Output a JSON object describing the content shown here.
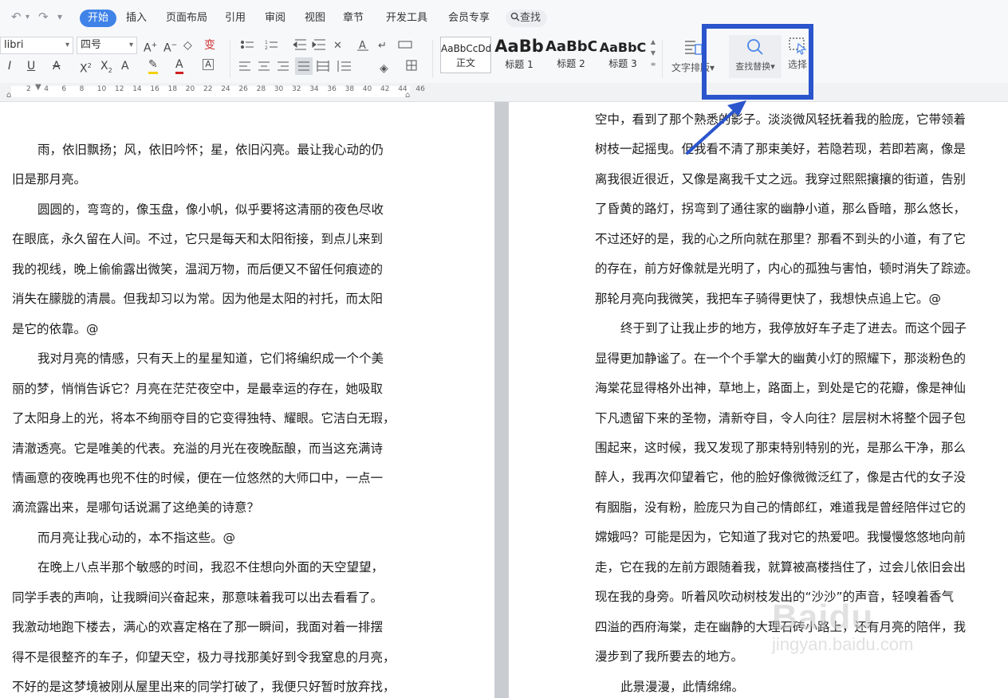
{
  "menu": {
    "tabs": [
      "开始",
      "插入",
      "页面布局",
      "引用",
      "审阅",
      "视图",
      "章节",
      "开发工具",
      "会员专享"
    ],
    "active_tab": "开始",
    "search_label": "查找",
    "undo_icon": "↶",
    "redo_icon": "↷"
  },
  "ribbon": {
    "font_name": "libri",
    "font_size": "四号",
    "styles": [
      {
        "sample": "AaBbCcDd",
        "name": "正文"
      },
      {
        "sample": "AaBb",
        "name": "标题 1"
      },
      {
        "sample": "AaBbC",
        "name": "标题 2"
      },
      {
        "sample": "AaBbC",
        "name": "标题 3"
      }
    ],
    "text_layout_label": "文字排版",
    "find_replace_label": "查找替换",
    "select_label": "选择",
    "tools_row1": [
      "A⁺",
      "A⁻",
      "♦",
      "变"
    ],
    "tools_row2": [
      "I",
      "U",
      "A",
      "X²",
      "X₂",
      "A",
      "A",
      "A"
    ]
  },
  "ruler": {
    "numbers": [
      "2",
      "4",
      "6",
      "8",
      "10",
      "12",
      "14",
      "16",
      "18",
      "20",
      "22",
      "24",
      "26",
      "28",
      "30",
      "32",
      "34",
      "36",
      "38",
      "40",
      "42",
      "44",
      "46"
    ]
  },
  "document": {
    "left_page": [
      {
        "text": "雨，依旧飘扬；风，依旧吟怀；星，依旧闪亮。最让我心动的仍",
        "indent": true
      },
      {
        "text": "旧是那月亮。",
        "indent": false
      },
      {
        "text": "圆圆的，弯弯的，像玉盘，像小帆，似乎要将这清丽的夜色尽收",
        "indent": true
      },
      {
        "text": "在眼底，永久留在人间。不过，它只是每天和太阳衔接，到点儿来到",
        "indent": false
      },
      {
        "text": "我的视线，晚上偷偷露出微笑，温润万物，而后便又不留任何痕迹的",
        "indent": false
      },
      {
        "text": "消失在朦胧的清晨。但我却习以为常。因为他是太阳的衬托，而太阳",
        "indent": false
      },
      {
        "text": "是它的依靠。@",
        "indent": false
      },
      {
        "text": "我对月亮的情感，只有天上的星星知道，它们将编织成一个个美",
        "indent": true
      },
      {
        "text": "丽的梦，悄悄告诉它？月亮在茫茫夜空中，是最幸运的存在，她吸取",
        "indent": false
      },
      {
        "text": "了太阳身上的光，将本不绚丽夺目的它变得独特、耀眼。它洁白无瑕，",
        "indent": false
      },
      {
        "text": "清澈透亮。它是唯美的代表。充溢的月光在夜晚酝酿，而当这充满诗",
        "indent": false
      },
      {
        "text": "情画意的夜晚再也兜不住的时候，便在一位悠然的大师口中，一点一",
        "indent": false
      },
      {
        "text": "滴流露出来，是哪句话说漏了这绝美的诗意？",
        "indent": false
      },
      {
        "text": "而月亮让我心动的，本不指这些。@",
        "indent": true
      },
      {
        "text": "在晚上八点半那个敏感的时间，我忍不住想向外面的天空望望，",
        "indent": true
      },
      {
        "text": "同学手表的声响，让我瞬间兴奋起来，那意味着我可以出去看看了。",
        "indent": false
      },
      {
        "text": "我激动地跑下楼去，满心的欢喜定格在了那一瞬间，我面对着一排摆",
        "indent": false
      },
      {
        "text": "得不是很整齐的车子，仰望天空，极力寻找那美好到令我窒息的月亮，",
        "indent": false
      },
      {
        "text": "不好的是这梦境被刚从屋里出来的同学打破了，我便只好暂时放弃找，",
        "indent": false
      }
    ],
    "right_page": [
      {
        "text": "空中，看到了那个熟悉的影子。淡淡微风轻抚着我的脸庞，它带领着",
        "indent": false
      },
      {
        "text": "树枝一起摇曳。但我看不清了那束美好，若隐若现，若即若离，像是",
        "indent": false
      },
      {
        "text": "离我很近很近，又像是离我千丈之远。我穿过熙熙攘攘的街道，告别",
        "indent": false
      },
      {
        "text": "了昏黄的路灯，拐弯到了通往家的幽静小道，那么昏暗，那么悠长，",
        "indent": false
      },
      {
        "text": "不过还好的是，我的心之所向就在那里？那看不到头的小道，有了它",
        "indent": false
      },
      {
        "text": "的存在，前方好像就是光明了，内心的孤独与害怕，顿时消失了踪迹。",
        "indent": false
      },
      {
        "text": "那轮月亮向我微笑，我把车子骑得更快了，我想快点追上它。@",
        "indent": false
      },
      {
        "text": "终于到了让我止步的地方，我停放好车子走了进去。而这个园子",
        "indent": true
      },
      {
        "text": "显得更加静谧了。在一个个手掌大的幽黄小灯的照耀下，那淡粉色的",
        "indent": false
      },
      {
        "text": "海棠花显得格外出神，草地上，路面上，到处是它的花瓣，像是神仙",
        "indent": false
      },
      {
        "text": "下凡遗留下来的圣物，清新夺目，令人向往？层层树木将整个园子包",
        "indent": false
      },
      {
        "text": "围起来，这时候，我又发现了那束特别特别的光，是那么干净，那么",
        "indent": false
      },
      {
        "text": "醉人，我再次仰望着它，他的脸好像微微泛红了，像是古代的女子没",
        "indent": false
      },
      {
        "text": "有胭脂，没有粉，脸庞只为自己的情郎红，难道我是曾经陪伴过它的",
        "indent": false
      },
      {
        "text": "嫦娥吗？可能是因为，它知道了我对它的热爱吧。我慢慢悠悠地向前",
        "indent": false
      },
      {
        "text": "走，它在我的左前方跟随着我，就算被高楼挡住了，过会儿依旧会出",
        "indent": false
      },
      {
        "text": "现在我的身旁。听着风吹动树枝发出的“沙沙”的声音，轻嗅着香气",
        "indent": false
      },
      {
        "text": "四溢的西府海棠，走在幽静的大理石砖小路上，还有月亮的陪伴，我",
        "indent": false
      },
      {
        "text": "漫步到了我所要去的地方。",
        "indent": false
      },
      {
        "text": "此景漫漫，此情绵绵。",
        "indent": true
      }
    ]
  },
  "watermark": {
    "brand": "Baidu",
    "url": "jingyan.baidu.com"
  },
  "colors": {
    "accent": "#3f83e8",
    "highlight": "#2a55cc",
    "gutter": "#c9cdd2"
  }
}
